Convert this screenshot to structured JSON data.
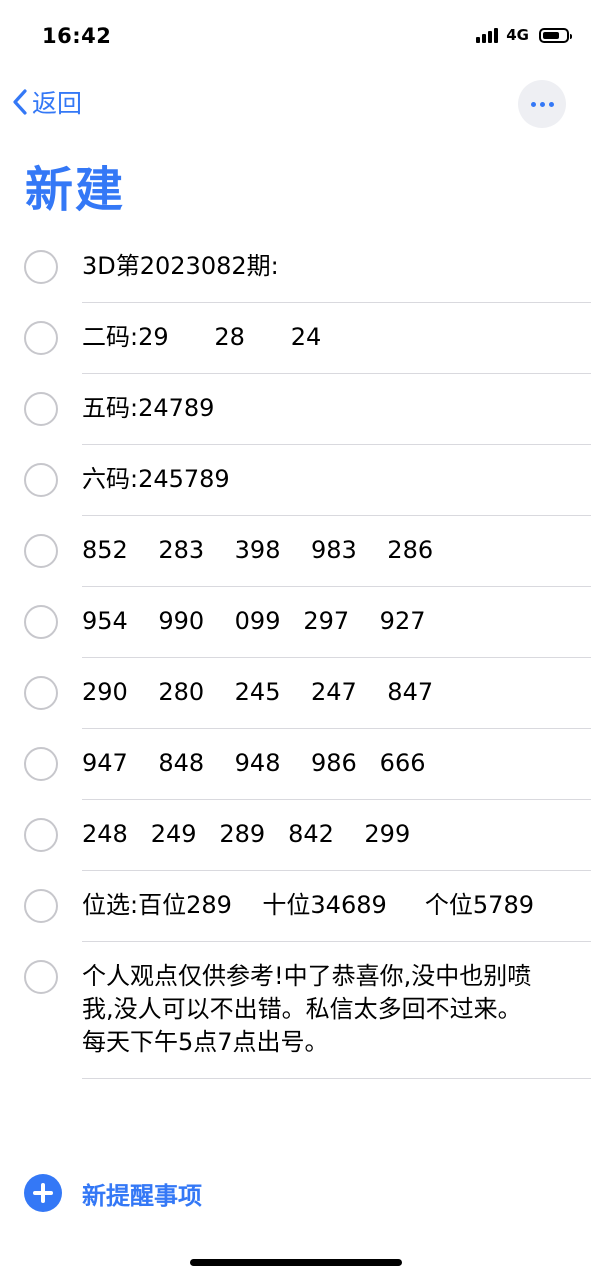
{
  "status": {
    "time": "16:42",
    "network": "4G"
  },
  "nav": {
    "back_label": "返回"
  },
  "list": {
    "title": "新建",
    "accent_color": "#3478f6",
    "items": [
      {
        "text": "3D第2023082期:"
      },
      {
        "text": "二码:29      28      24"
      },
      {
        "text": "五码:24789"
      },
      {
        "text": "六码:245789"
      },
      {
        "text": "852    283    398    983    286"
      },
      {
        "text": "954    990    099   297    927"
      },
      {
        "text": "290    280    245    247    847"
      },
      {
        "text": "947    848    948    986   666"
      },
      {
        "text": "248   249   289   842    299"
      },
      {
        "text": "位选:百位289    十位34689     个位5789"
      },
      {
        "text": "个人观点仅供参考!中了恭喜你,没中也别喷我,没人可以不出错。私信太多回不过来。每天下午5点7点出号。"
      }
    ]
  },
  "add_reminder": {
    "label": "新提醒事项"
  }
}
